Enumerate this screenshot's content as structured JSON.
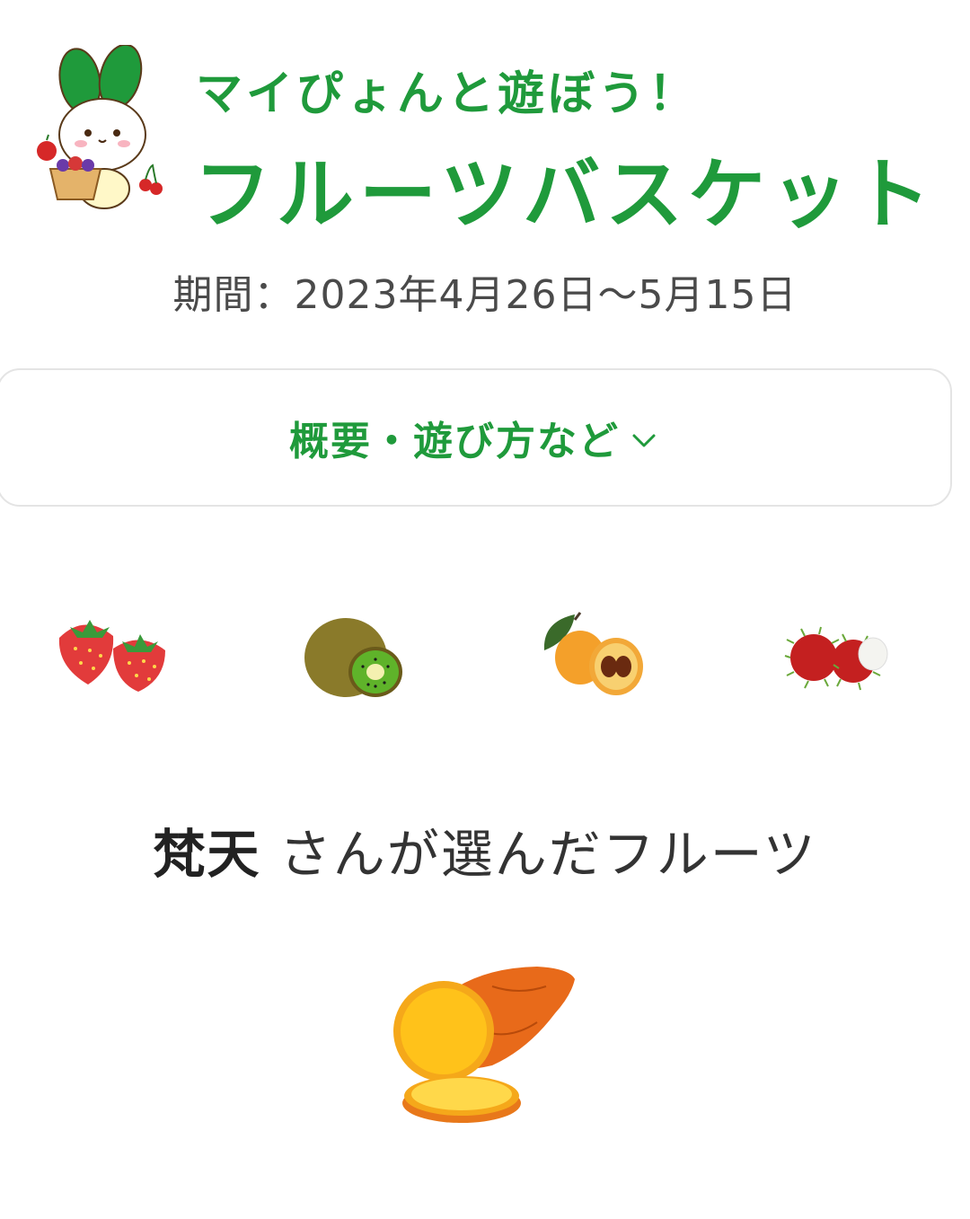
{
  "header": {
    "subtitle": "マイぴょんと遊ぼう！",
    "title": "フルーツバスケット"
  },
  "period": "期間：2023年4月26日～5月15日",
  "accordion": {
    "label": "概要・遊び方など"
  },
  "fruits": [
    {
      "name": "strawberry"
    },
    {
      "name": "kiwi"
    },
    {
      "name": "loquat"
    },
    {
      "name": "rambutan"
    }
  ],
  "chosen": {
    "user": "梵天",
    "suffix": " さんが選んだフルーツ",
    "fruit": "sweet-potato"
  },
  "colors": {
    "accent": "#1f9a3b",
    "text": "#4a4a4a",
    "border": "#e4e4e4"
  }
}
